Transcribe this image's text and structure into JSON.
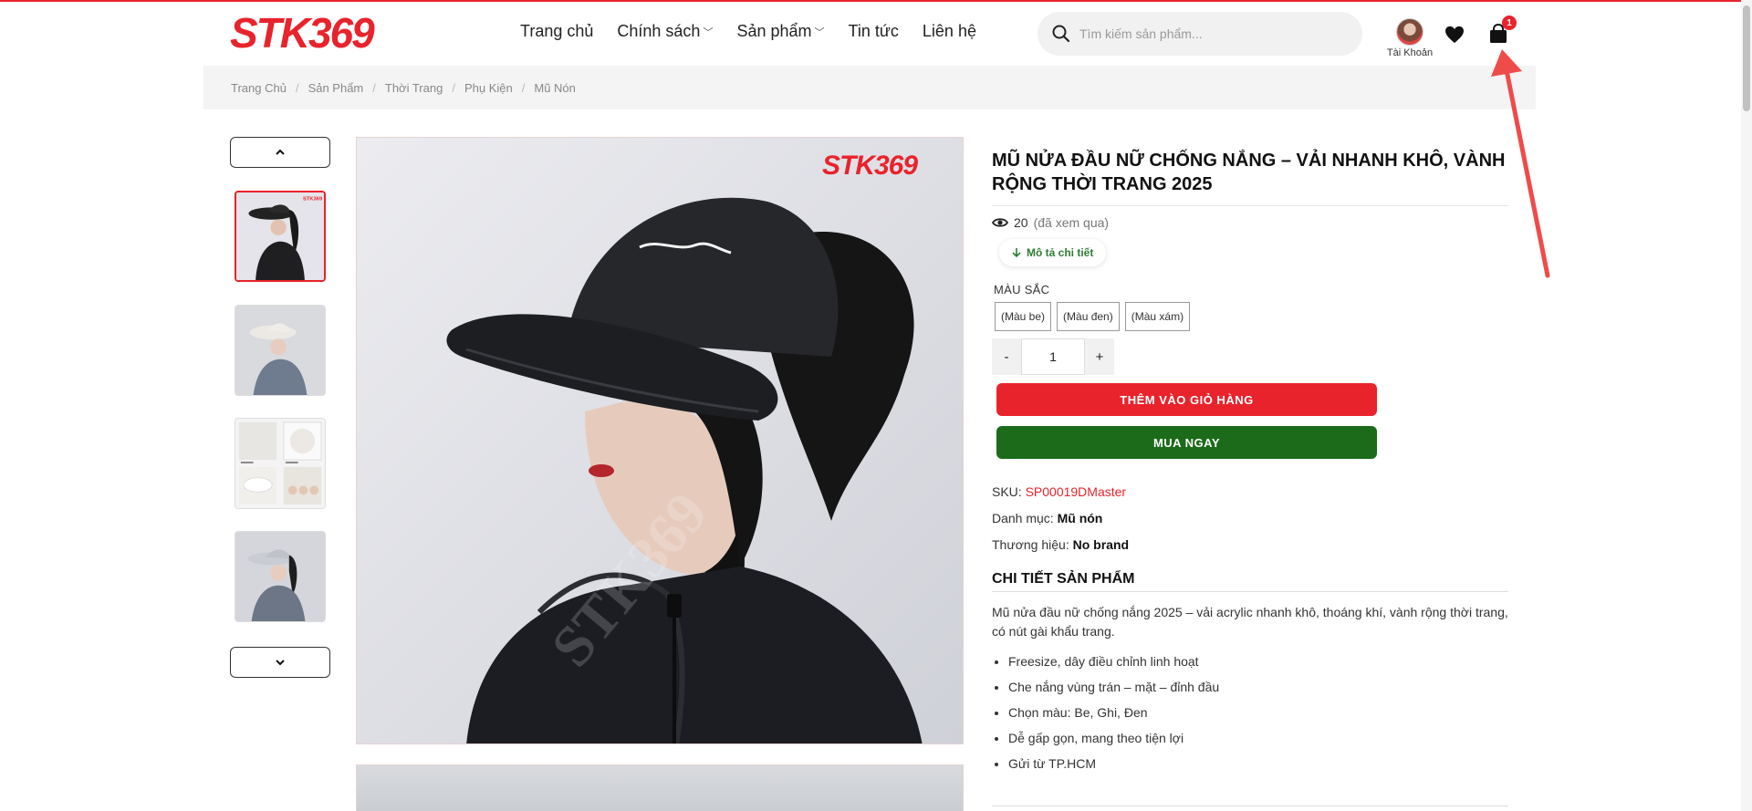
{
  "brand": {
    "logo_text": "STK369",
    "accent": "#e8232c",
    "buy_color": "#1b6b1b"
  },
  "nav": {
    "items": [
      {
        "label": "Trang chủ",
        "has_dropdown": false
      },
      {
        "label": "Chính sách",
        "has_dropdown": true
      },
      {
        "label": "Sản phẩm",
        "has_dropdown": true
      },
      {
        "label": "Tin tức",
        "has_dropdown": false
      },
      {
        "label": "Liên hệ",
        "has_dropdown": false
      }
    ]
  },
  "search": {
    "placeholder": "Tìm kiếm sản phẩm...",
    "icon": "search-icon"
  },
  "account": {
    "label": "Tài Khoản"
  },
  "cart": {
    "count": "1"
  },
  "breadcrumb": [
    "Trang Chủ",
    "Sản Phẩm",
    "Thời Trang",
    "Phụ Kiện",
    "Mũ Nón"
  ],
  "gallery": {
    "up_icon": "chevron-up-icon",
    "down_icon": "chevron-down-icon",
    "watermark": "STK369"
  },
  "product": {
    "title": "MŨ NỬA ĐẦU NỮ CHỐNG NẮNG – VẢI NHANH KHÔ, VÀNH RỘNG THỜI TRANG 2025",
    "views_count": "20",
    "views_label": "(đã xem qua)",
    "desc_button": "Mô tả chi tiết",
    "color_label": "MÀU SẮC",
    "colors": [
      "(Màu be)",
      "(Màu đen)",
      "(Màu xám)"
    ],
    "quantity": "1",
    "minus": "-",
    "plus": "+",
    "add_to_cart": "THÊM VÀO GIỎ HÀNG",
    "buy_now": "MUA NGAY",
    "sku_label": "SKU:",
    "sku": "SP00019DMaster",
    "category_label": "Danh mục:",
    "category": "Mũ nón",
    "brand_label": "Thương hiệu:",
    "brand": "No brand",
    "detail_heading": "CHI TIẾT SẢN PHẨM",
    "detail_text": "Mũ nửa đầu nữ chống nắng 2025 – vải acrylic nhanh khô, thoáng khí, vành rộng thời trang, có nút gài khẩu trang.",
    "bullets": [
      "Freesize, dây điều chỉnh linh hoạt",
      "Che nắng vùng trán – mặt – đỉnh đầu",
      "Chọn màu: Be, Ghi, Đen",
      "Dễ gấp gọn, mang theo tiện lợi",
      "Gửi từ TP.HCM"
    ]
  }
}
